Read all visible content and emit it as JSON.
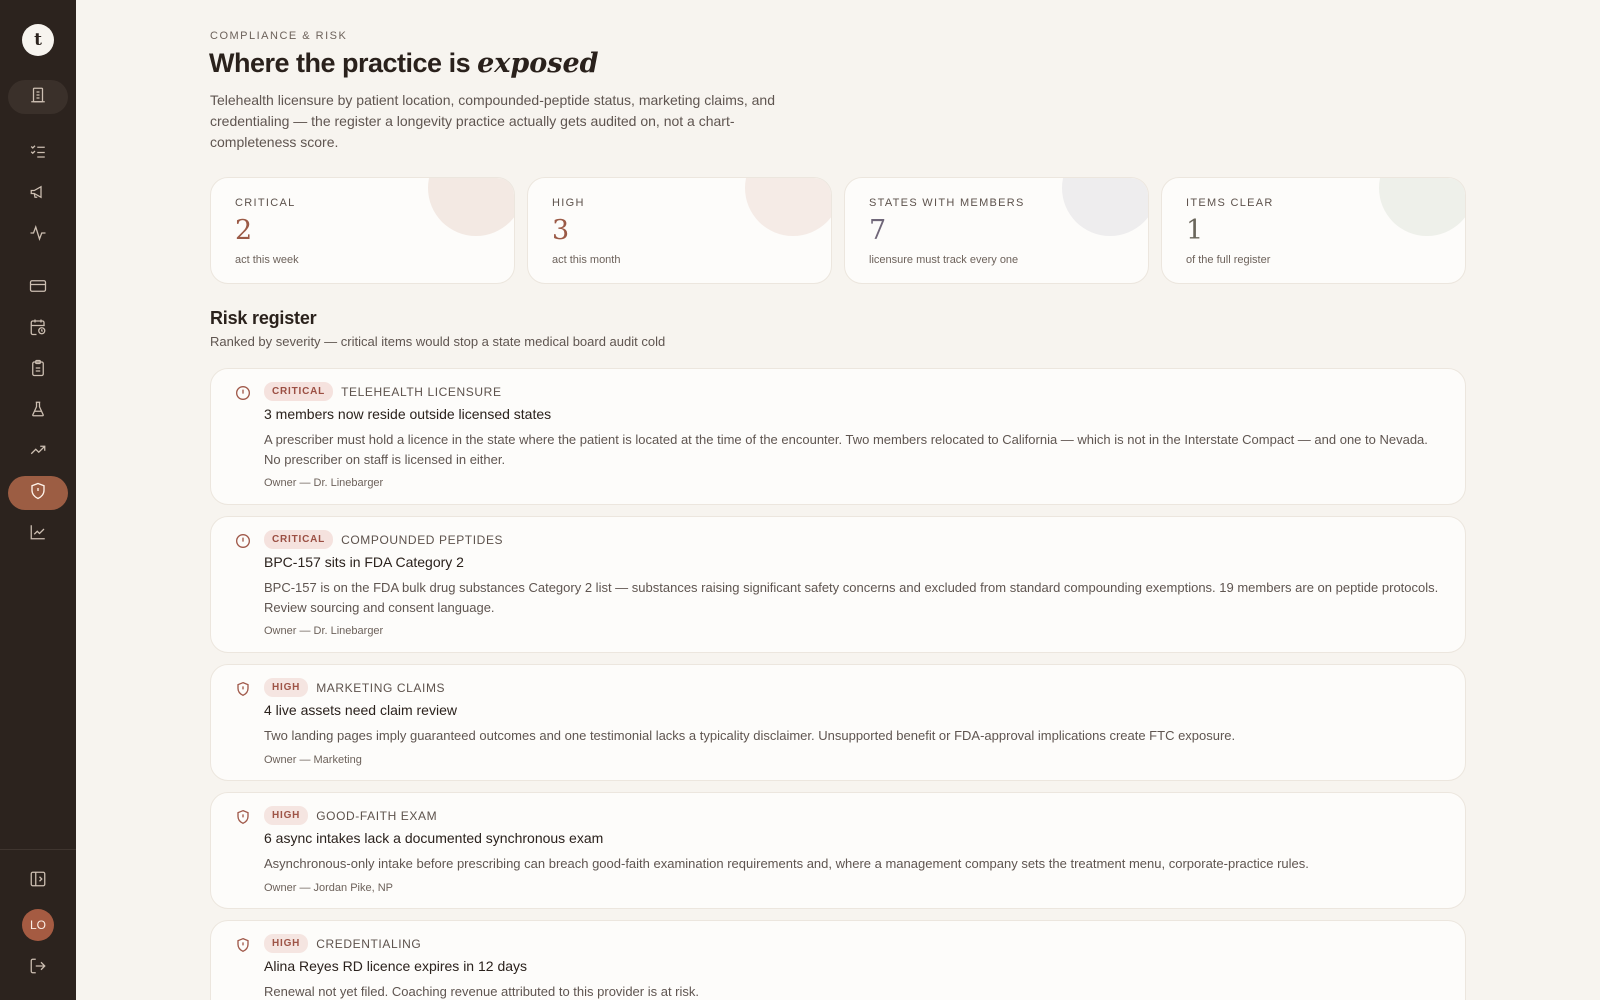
{
  "sidebar": {
    "logo": "t",
    "nav": [
      {
        "icon": "building-icon",
        "state": "home"
      },
      {
        "icon": "checklist-icon",
        "state": "default"
      },
      {
        "icon": "megaphone-icon",
        "state": "default"
      },
      {
        "icon": "pulse-icon",
        "state": "default"
      },
      {
        "icon": "credit-card-icon",
        "state": "default"
      },
      {
        "icon": "calendar-clock-icon",
        "state": "default"
      },
      {
        "icon": "clipboard-icon",
        "state": "default"
      },
      {
        "icon": "flask-icon",
        "state": "default"
      },
      {
        "icon": "trending-up-icon",
        "state": "default"
      },
      {
        "icon": "shield-alert-icon",
        "state": "active"
      },
      {
        "icon": "line-chart-icon",
        "state": "default"
      }
    ],
    "footer": {
      "collapse_icon": "panel-left-icon",
      "avatar": "LO",
      "logout_icon": "log-out-icon"
    }
  },
  "header": {
    "eyebrow": "COMPLIANCE & RISK",
    "title_prefix": "Where the practice is ",
    "title_emphasis": "exposed",
    "intro": "Telehealth licensure by patient location, compounded-peptide status, marketing claims, and credentialing — the register a longevity practice actually gets audited on, not a chart-completeness score."
  },
  "stats": [
    {
      "label": "CRITICAL",
      "value": "2",
      "sub": "act this week",
      "value_color": "#9b5a46",
      "accent": "#f3e9e3"
    },
    {
      "label": "HIGH",
      "value": "3",
      "sub": "act this month",
      "value_color": "#9b5a46",
      "accent": "#f5ebe6"
    },
    {
      "label": "STATES WITH MEMBERS",
      "value": "7",
      "sub": "licensure must track every one",
      "value_color": "#6f6678",
      "accent": "#eeedee"
    },
    {
      "label": "ITEMS CLEAR",
      "value": "1",
      "sub": "of the full register",
      "value_color": "#6a665b",
      "accent": "#eef0ea"
    }
  ],
  "register": {
    "title": "Risk register",
    "subtitle": "Ranked by severity — critical items would stop a state medical board audit cold",
    "items": [
      {
        "severity": "CRITICAL",
        "severity_key": "critical",
        "icon": "alert-circle-icon",
        "category": "TELEHEALTH LICENSURE",
        "title": "3 members now reside outside licensed states",
        "description": "A prescriber must hold a licence in the state where the patient is located at the time of the encounter. Two members relocated to California — which is not in the Interstate Compact — and one to Nevada. No prescriber on staff is licensed in either.",
        "owner": "Owner — Dr. Linebarger"
      },
      {
        "severity": "CRITICAL",
        "severity_key": "critical",
        "icon": "alert-circle-icon",
        "category": "COMPOUNDED PEPTIDES",
        "title": "BPC-157 sits in FDA Category 2",
        "description": "BPC-157 is on the FDA bulk drug substances Category 2 list — substances raising significant safety concerns and excluded from standard compounding exemptions. 19 members are on peptide protocols. Review sourcing and consent language.",
        "owner": "Owner — Dr. Linebarger"
      },
      {
        "severity": "HIGH",
        "severity_key": "high",
        "icon": "shield-alert-icon",
        "category": "MARKETING CLAIMS",
        "title": "4 live assets need claim review",
        "description": "Two landing pages imply guaranteed outcomes and one testimonial lacks a typicality disclaimer. Unsupported benefit or FDA-approval implications create FTC exposure.",
        "owner": "Owner — Marketing"
      },
      {
        "severity": "HIGH",
        "severity_key": "high",
        "icon": "shield-alert-icon",
        "category": "GOOD-FAITH EXAM",
        "title": "6 async intakes lack a documented synchronous exam",
        "description": "Asynchronous-only intake before prescribing can breach good-faith examination requirements and, where a management company sets the treatment menu, corporate-practice rules.",
        "owner": "Owner — Jordan Pike, NP"
      },
      {
        "severity": "HIGH",
        "severity_key": "high",
        "icon": "shield-alert-icon",
        "category": "CREDENTIALING",
        "title": "Alina Reyes RD licence expires in 12 days",
        "description": "Renewal not yet filed. Coaching revenue attributed to this provider is at risk.",
        "owner": ""
      }
    ]
  }
}
